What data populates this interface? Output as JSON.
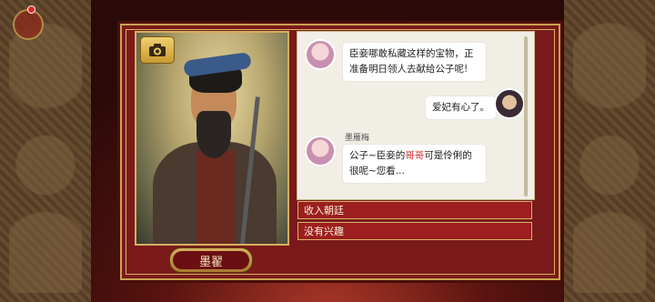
{
  "character": {
    "name": "墨翟"
  },
  "icons": {
    "camera": "camera-icon"
  },
  "chat": {
    "messages": [
      {
        "side": "left",
        "avatar": "concubine-avatar",
        "sender": "",
        "text": "臣妾哪敢私藏这样的宝物，正准备明日领人去献给公子呢!"
      },
      {
        "side": "right",
        "avatar": "player-avatar",
        "sender": "",
        "text": "爱妃有心了。"
      },
      {
        "side": "left",
        "avatar": "concubine-avatar",
        "sender": "墨雁梅",
        "text_before": "公子~臣妾的",
        "text_highlight": "哥哥",
        "text_after": "可是伶俐的很呢~您看..."
      }
    ]
  },
  "options": [
    "收入朝廷",
    "没有兴趣"
  ],
  "colors": {
    "panel": "#7a1a1a",
    "gold": "#c9a14f",
    "option": "#9c1e1e",
    "highlight": "#d63a3a"
  }
}
